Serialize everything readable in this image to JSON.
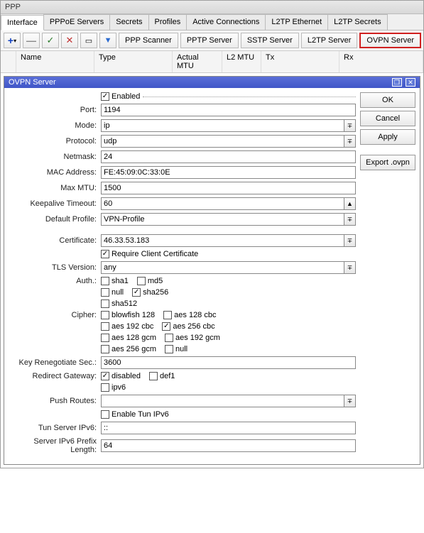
{
  "titlebar": "PPP",
  "tabs": [
    "Interface",
    "PPPoE Servers",
    "Secrets",
    "Profiles",
    "Active Connections",
    "L2TP Ethernet",
    "L2TP Secrets"
  ],
  "activeTab": "Interface",
  "toolbarButtons": {
    "pppScanner": "PPP Scanner",
    "pptpServer": "PPTP Server",
    "sstpServer": "SSTP Server",
    "l2tpServer": "L2TP Server",
    "ovpnServer": "OVPN Server"
  },
  "listHeaders": {
    "name": "Name",
    "type": "Type",
    "actualMtu": "Actual MTU",
    "l2mtu": "L2 MTU",
    "tx": "Tx",
    "rx": "Rx"
  },
  "subwindow": {
    "title": "OVPN Server"
  },
  "buttons": {
    "ok": "OK",
    "cancel": "Cancel",
    "apply": "Apply",
    "export": "Export .ovpn"
  },
  "labels": {
    "enabled": "Enabled",
    "port": "Port:",
    "mode": "Mode:",
    "protocol": "Protocol:",
    "netmask": "Netmask:",
    "mac": "MAC Address:",
    "maxMtu": "Max MTU:",
    "keepalive": "Keepalive Timeout:",
    "defProfile": "Default Profile:",
    "certificate": "Certificate:",
    "reqClient": "Require Client Certificate",
    "tlsVersion": "TLS Version:",
    "auth": "Auth.:",
    "cipher": "Cipher:",
    "keyReneg": "Key Renegotiate Sec.:",
    "redirGw": "Redirect Gateway:",
    "ipv6": "ipv6",
    "pushRoutes": "Push Routes:",
    "enableTun": "Enable Tun IPv6",
    "tunServer": "Tun Server IPv6:",
    "prefixLen": "Server IPv6 Prefix Length:"
  },
  "values": {
    "port": "1194",
    "mode": "ip",
    "protocol": "udp",
    "netmask": "24",
    "mac": "FE:45:09:0C:33:0E",
    "maxMtu": "1500",
    "keepalive": "60",
    "defProfile": "VPN-Profile",
    "certificate": "46.33.53.183",
    "tlsVersion": "any",
    "keyReneg": "3600",
    "pushRoutes": "",
    "tunServer": "::",
    "prefixLen": "64"
  },
  "auth": {
    "sha1": "sha1",
    "md5": "md5",
    "null": "null",
    "sha256": "sha256",
    "sha512": "sha512"
  },
  "cipher": {
    "blowfish": "blowfish 128",
    "aes128cbc": "aes 128 cbc",
    "aes192cbc": "aes 192 cbc",
    "aes256cbc": "aes 256 cbc",
    "aes128gcm": "aes 128 gcm",
    "aes192gcm": "aes 192 gcm",
    "aes256gcm": "aes 256 gcm",
    "null": "null"
  },
  "redir": {
    "disabled": "disabled",
    "def1": "def1"
  }
}
